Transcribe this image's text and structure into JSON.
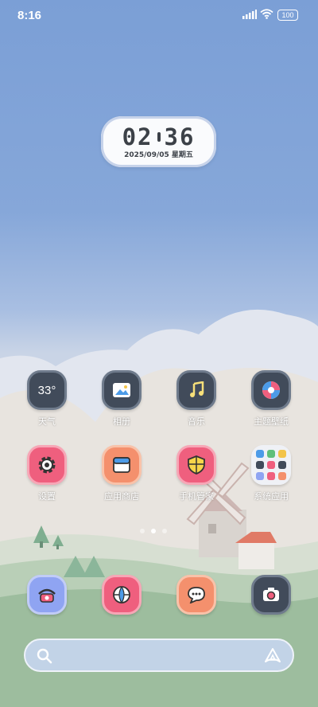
{
  "status_bar": {
    "time": "8:16",
    "battery": "100"
  },
  "clock_widget": {
    "hours": "02",
    "minutes": "36",
    "date": "2025/09/05 星期五"
  },
  "weather_temp": "33°",
  "apps_row1": [
    {
      "label": "天气",
      "icon": "weather-icon"
    },
    {
      "label": "相册",
      "icon": "gallery-icon"
    },
    {
      "label": "音乐",
      "icon": "music-icon"
    },
    {
      "label": "主题壁纸",
      "icon": "themes-icon"
    }
  ],
  "apps_row2": [
    {
      "label": "设置",
      "icon": "gear-icon"
    },
    {
      "label": "应用商店",
      "icon": "store-icon"
    },
    {
      "label": "手机管家",
      "icon": "shield-icon"
    },
    {
      "label": "系统应用",
      "icon": "folder-icon"
    }
  ],
  "dock": [
    {
      "name": "phone",
      "icon": "phone-icon"
    },
    {
      "name": "browser",
      "icon": "browser-icon"
    },
    {
      "name": "messages",
      "icon": "message-icon"
    },
    {
      "name": "camera",
      "icon": "camera-icon"
    }
  ],
  "page_indicator": {
    "count": 3,
    "active": 2
  },
  "colors": {
    "sky": "#7b9fd6",
    "dark_icon": "#414b5a",
    "pink_icon": "#ef5f7e",
    "peach_icon": "#f4906d",
    "blue_icon": "#8fa4f2"
  }
}
